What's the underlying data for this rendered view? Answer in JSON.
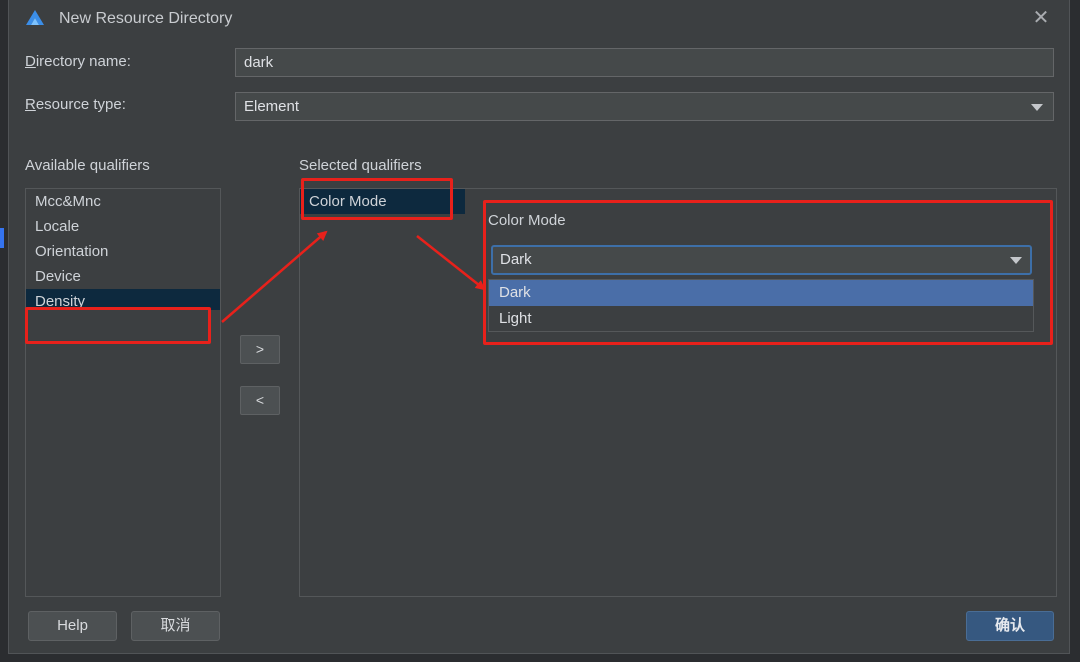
{
  "window": {
    "title": "New Resource Directory"
  },
  "icons": {
    "app": "deveco-logo-icon",
    "close": "close-icon",
    "dropdown": "chevron-down-icon"
  },
  "form": {
    "directory_name_label_u": "D",
    "directory_name_label_rest": "irectory name:",
    "directory_name_value": "dark",
    "resource_type_label_u": "R",
    "resource_type_label_rest": "esource type:",
    "resource_type_value": "Element"
  },
  "available": {
    "heading": "Available qualifiers",
    "items": [
      "Mcc&Mnc",
      "Locale",
      "Orientation",
      "Device",
      "Density"
    ],
    "selected_index": 4
  },
  "transfer": {
    "add": ">",
    "remove": "<"
  },
  "selected": {
    "heading": "Selected qualifiers",
    "items": [
      "Color Mode"
    ]
  },
  "detail": {
    "label": "Color Mode",
    "value": "Dark",
    "options": [
      "Dark",
      "Light"
    ],
    "highlighted": "Dark"
  },
  "buttons": {
    "help": "Help",
    "cancel": "取消",
    "ok": "确认"
  },
  "colors": {
    "accent": "#365880",
    "highlight": "#4a6ea8",
    "annotation": "#e8211b"
  }
}
